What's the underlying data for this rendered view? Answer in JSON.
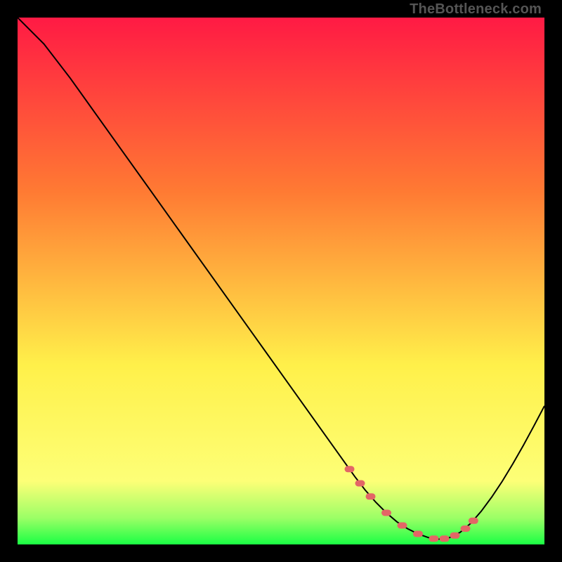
{
  "watermark": "TheBottleneck.com",
  "chart_data": {
    "type": "line",
    "title": "",
    "xlabel": "",
    "ylabel": "",
    "xlim": [
      0,
      100
    ],
    "ylim": [
      0,
      100
    ],
    "grid": false,
    "legend": false,
    "series": [
      {
        "name": "bottleneck-curve",
        "x": [
          0,
          5,
          10,
          15,
          20,
          25,
          30,
          35,
          40,
          45,
          50,
          55,
          60,
          62,
          64,
          66,
          68,
          70,
          72,
          74,
          76,
          78,
          80,
          82,
          84,
          86,
          88,
          90,
          92,
          94,
          96,
          98,
          100
        ],
        "y": [
          100,
          95,
          88.5,
          81.5,
          74.5,
          67.5,
          60.5,
          53.5,
          46.5,
          39.5,
          32.5,
          25.5,
          18.5,
          15.7,
          12.9,
          10.3,
          8.0,
          6.0,
          4.3,
          3.0,
          2.0,
          1.3,
          1.0,
          1.3,
          2.3,
          4.0,
          6.3,
          9.0,
          12.0,
          15.3,
          18.8,
          22.5,
          26.3
        ]
      }
    ],
    "optimal_points": {
      "name": "optimal-zone-dots",
      "x": [
        63,
        65,
        67,
        70,
        73,
        76,
        79,
        81,
        83,
        85,
        86.5
      ],
      "y": [
        14.3,
        11.6,
        9.1,
        6.0,
        3.6,
        2.0,
        1.1,
        1.1,
        1.7,
        3.0,
        4.5
      ]
    },
    "gradient_stops": [
      {
        "pos": 0.0,
        "color": "#ff1a44"
      },
      {
        "pos": 0.33,
        "color": "#ff7a33"
      },
      {
        "pos": 0.66,
        "color": "#fff04a"
      },
      {
        "pos": 0.88,
        "color": "#fdff77"
      },
      {
        "pos": 0.95,
        "color": "#9bff66"
      },
      {
        "pos": 1.0,
        "color": "#1aff44"
      }
    ]
  }
}
